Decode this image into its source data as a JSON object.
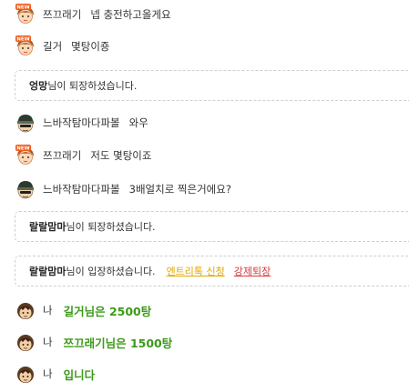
{
  "messages": [
    {
      "type": "chat",
      "avatar": "new-girl-avatar-icon",
      "nick": "쯔끄래기",
      "text": "넵 충전하고올게요"
    },
    {
      "type": "chat",
      "avatar": "new-girl-avatar-icon",
      "nick": "길거",
      "text": "몇탕이죵"
    },
    {
      "type": "notice",
      "nick": "엉망",
      "text": "님이 퇴장하셨습니다."
    },
    {
      "type": "chat",
      "avatar": "helmet-avatar-icon",
      "nick": "느바작탐마다파볼",
      "text": "와우"
    },
    {
      "type": "chat",
      "avatar": "new-girl-avatar-icon",
      "nick": "쯔끄래기",
      "text": "저도 몇탕이죠"
    },
    {
      "type": "chat",
      "avatar": "helmet-avatar-icon",
      "nick": "느바작탐마다파볼",
      "text": "3배얼치로 찍은거에요?"
    },
    {
      "type": "notice",
      "nick": "랄랄맘마",
      "text": "님이 퇴장하셨습니다."
    },
    {
      "type": "notice",
      "nick": "랄랄맘마",
      "text": "님이 입장하셨습니다.",
      "link1": "엔트리톡 신청",
      "link2": "강제퇴장"
    },
    {
      "type": "me",
      "avatar": "me-avatar-icon",
      "nick": "나",
      "text": "길거님은 2500탕"
    },
    {
      "type": "me",
      "avatar": "me-avatar-icon",
      "nick": "나",
      "text": "쯔끄래기님은 1500탕"
    },
    {
      "type": "me",
      "avatar": "me-avatar-icon",
      "nick": "나",
      "text": "입니다"
    }
  ],
  "badge": "NEW",
  "colors": {
    "my_text": "#3c9a1a",
    "entry_link": "#e0a800",
    "kick_link": "#d83a3a",
    "notice_border": "#cfcfcf"
  }
}
